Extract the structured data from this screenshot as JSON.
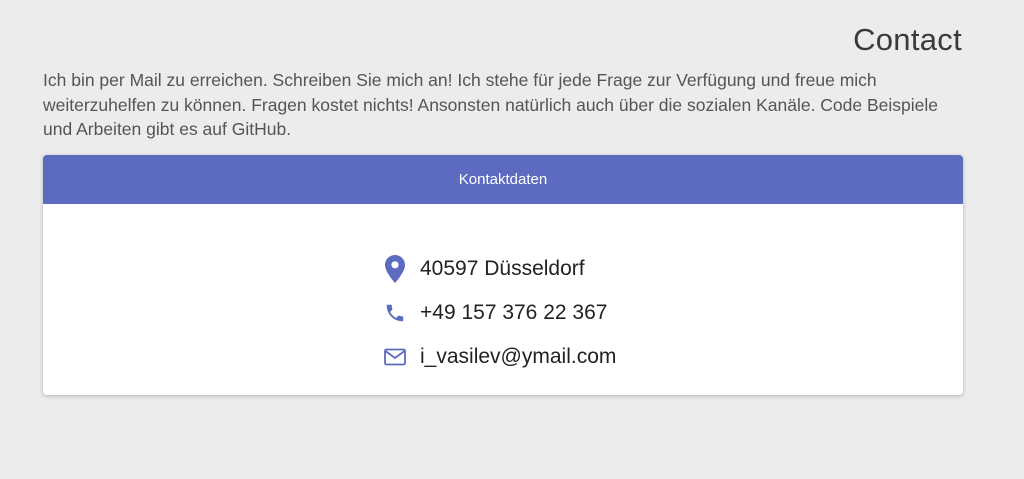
{
  "header": {
    "title": "Contact"
  },
  "intro": {
    "text": "Ich bin per Mail zu erreichen. Schreiben Sie mich an! Ich stehe für jede Frage zur Verfügung und freue mich weiterzuhelfen zu können. Fragen kostet nichts! Ansonsten natürlich auch über die sozialen Kanäle. Code Beispiele und Arbeiten gibt es auf GitHub."
  },
  "card": {
    "header_label": "Kontaktdaten",
    "accent_color": "#5c6bc0",
    "items": [
      {
        "icon": "map-marker-icon",
        "text": "40597 Düsseldorf"
      },
      {
        "icon": "phone-icon",
        "text": "+49 157 376 22 367"
      },
      {
        "icon": "envelope-icon",
        "text": "i_vasilev@ymail.com"
      }
    ]
  }
}
